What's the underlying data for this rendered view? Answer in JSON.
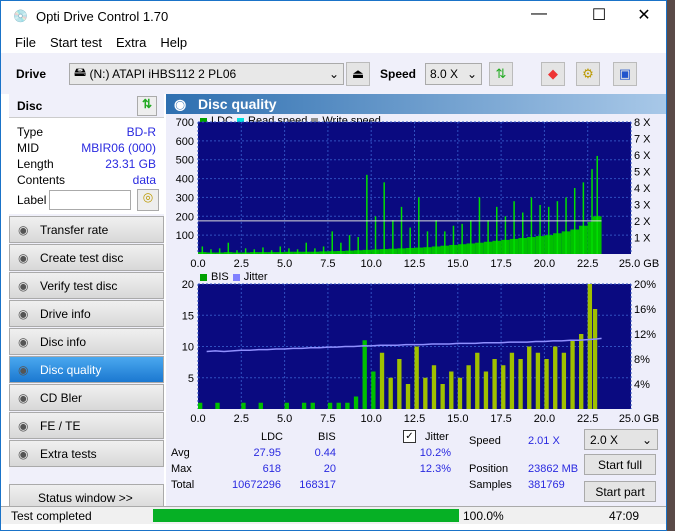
{
  "app": {
    "title": "Opti Drive Control 1.70"
  },
  "menu": [
    "File",
    "Start test",
    "Extra",
    "Help"
  ],
  "toolbar": {
    "drive_label": "Drive",
    "drive_value": "(N:)  ATAPI iHBS112   2 PL06",
    "speed_label": "Speed",
    "speed_value": "8.0 X"
  },
  "disc": {
    "header": "Disc",
    "rows": [
      {
        "k": "Type",
        "v": "BD-R"
      },
      {
        "k": "MID",
        "v": "MBIR06 (000)"
      },
      {
        "k": "Length",
        "v": "23.31 GB"
      },
      {
        "k": "Contents",
        "v": "data"
      }
    ],
    "label_key": "Label",
    "label_value": ""
  },
  "nav": [
    "Transfer rate",
    "Create test disc",
    "Verify test disc",
    "Drive info",
    "Disc info",
    "Disc quality",
    "CD Bler",
    "FE / TE",
    "Extra tests"
  ],
  "nav_active": "Disc quality",
  "status_window": "Status window >>",
  "main": {
    "title": "Disc quality"
  },
  "chart_data": [
    {
      "type": "bar",
      "legend": [
        "LDC",
        "Read speed",
        "Write speed"
      ],
      "colors": {
        "LDC": "#00c000",
        "Read speed": "#00e0e0",
        "Write speed": "#909090"
      },
      "x_ticks": [
        "0.0",
        "2.5",
        "5.0",
        "7.5",
        "10.0",
        "12.5",
        "15.0",
        "17.5",
        "20.0",
        "22.5",
        "25.0 GB"
      ],
      "y_ticks": [
        "100",
        "200",
        "300",
        "400",
        "500",
        "600",
        "700"
      ],
      "y2_ticks": [
        "1 X",
        "2 X",
        "3 X",
        "4 X",
        "5 X",
        "6 X",
        "7 X",
        "8 X"
      ],
      "xlim": [
        0,
        25
      ],
      "ylim": [
        0,
        700
      ],
      "y2lim": [
        0,
        8
      ],
      "x": [
        0.5,
        1,
        1.5,
        2,
        2.5,
        3,
        3.5,
        4,
        4.5,
        5,
        5.5,
        6,
        6.5,
        7,
        7.5,
        8,
        8.5,
        9,
        9.5,
        10,
        10.5,
        11,
        11.5,
        12,
        12.5,
        13,
        13.5,
        14,
        14.5,
        15,
        15.5,
        16,
        16.5,
        17,
        17.5,
        18,
        18.5,
        19,
        19.5,
        20,
        20.5,
        21,
        21.5,
        22,
        22.5,
        23,
        23.3
      ],
      "ldc": [
        40,
        25,
        30,
        60,
        20,
        30,
        25,
        35,
        20,
        40,
        30,
        25,
        60,
        30,
        40,
        120,
        60,
        100,
        90,
        420,
        200,
        380,
        180,
        250,
        140,
        300,
        120,
        180,
        120,
        150,
        160,
        180,
        300,
        180,
        250,
        200,
        280,
        220,
        300,
        260,
        250,
        280,
        300,
        350,
        380,
        450,
        520
      ],
      "ldc_base": [
        10,
        8,
        8,
        10,
        8,
        8,
        10,
        10,
        10,
        10,
        12,
        12,
        12,
        12,
        14,
        15,
        16,
        18,
        20,
        22,
        24,
        26,
        28,
        30,
        32,
        34,
        36,
        40,
        44,
        48,
        52,
        56,
        60,
        65,
        70,
        75,
        80,
        85,
        90,
        95,
        100,
        110,
        120,
        130,
        150,
        170,
        200
      ],
      "read_speed_x": 2.01
    },
    {
      "type": "bar",
      "legend": [
        "BIS",
        "Jitter"
      ],
      "colors": {
        "BIS": "#00c000",
        "Jitter": "#8080ff"
      },
      "x_ticks": [
        "0.0",
        "2.5",
        "5.0",
        "7.5",
        "10.0",
        "12.5",
        "15.0",
        "17.5",
        "20.0",
        "22.5",
        "25.0 GB"
      ],
      "y_ticks": [
        "5",
        "10",
        "15",
        "20"
      ],
      "y2_ticks": [
        "4%",
        "8%",
        "12%",
        "16%",
        "20%"
      ],
      "xlim": [
        0,
        25
      ],
      "ylim": [
        0,
        20
      ],
      "y2lim": [
        0,
        20
      ],
      "x": [
        0.5,
        1,
        1.5,
        2,
        2.5,
        3,
        3.5,
        4,
        4.5,
        5,
        5.5,
        6,
        6.5,
        7,
        7.5,
        8,
        8.5,
        9,
        9.5,
        10,
        10.5,
        11,
        11.5,
        12,
        12.5,
        13,
        13.5,
        14,
        14.5,
        15,
        15.5,
        16,
        16.5,
        17,
        17.5,
        18,
        18.5,
        19,
        19.5,
        20,
        20.5,
        21,
        21.5,
        22,
        22.5,
        23,
        23.3
      ],
      "bis": [
        1,
        0,
        1,
        0,
        0,
        1,
        0,
        1,
        0,
        0,
        1,
        0,
        1,
        1,
        0,
        1,
        1,
        1,
        2,
        11,
        6,
        9,
        5,
        8,
        4,
        10,
        5,
        7,
        4,
        6,
        5,
        7,
        9,
        6,
        8,
        7,
        9,
        8,
        10,
        9,
        8,
        10,
        9,
        11,
        12,
        20,
        16
      ],
      "jitter": [
        9.2,
        9.3,
        9.2,
        9.3,
        9.4,
        9.4,
        9.5,
        9.5,
        9.6,
        9.6,
        9.7,
        9.7,
        9.8,
        9.8,
        9.9,
        9.9,
        10,
        10,
        10.1,
        10.1,
        10.2,
        10.2,
        10.2,
        10.3,
        10.3,
        10.3,
        10.4,
        10.4,
        10.4,
        10.5,
        10.5,
        10.5,
        10.6,
        10.6,
        10.6,
        10.7,
        10.7,
        10.7,
        10.8,
        10.8,
        10.9,
        10.9,
        11,
        11,
        11.1,
        11.2,
        11.3
      ]
    }
  ],
  "stats": {
    "col_ldc": "LDC",
    "col_bis": "BIS",
    "jitter_label": "Jitter",
    "jitter_checked": true,
    "rows": [
      {
        "k": "Avg",
        "ldc": "27.95",
        "bis": "0.44",
        "jit": "10.2%"
      },
      {
        "k": "Max",
        "ldc": "618",
        "bis": "20",
        "jit": "12.3%"
      },
      {
        "k": "Total",
        "ldc": "10672296",
        "bis": "168317",
        "jit": ""
      }
    ],
    "speed_label": "Speed",
    "speed_value": "2.01 X",
    "position_label": "Position",
    "position_value": "23862 MB",
    "samples_label": "Samples",
    "samples_value": "381769",
    "speed_select": "2.0 X",
    "start_full": "Start full",
    "start_part": "Start part"
  },
  "status": {
    "text": "Test completed",
    "progress": 100.0,
    "progress_text": "100.0%",
    "time": "47:09"
  }
}
